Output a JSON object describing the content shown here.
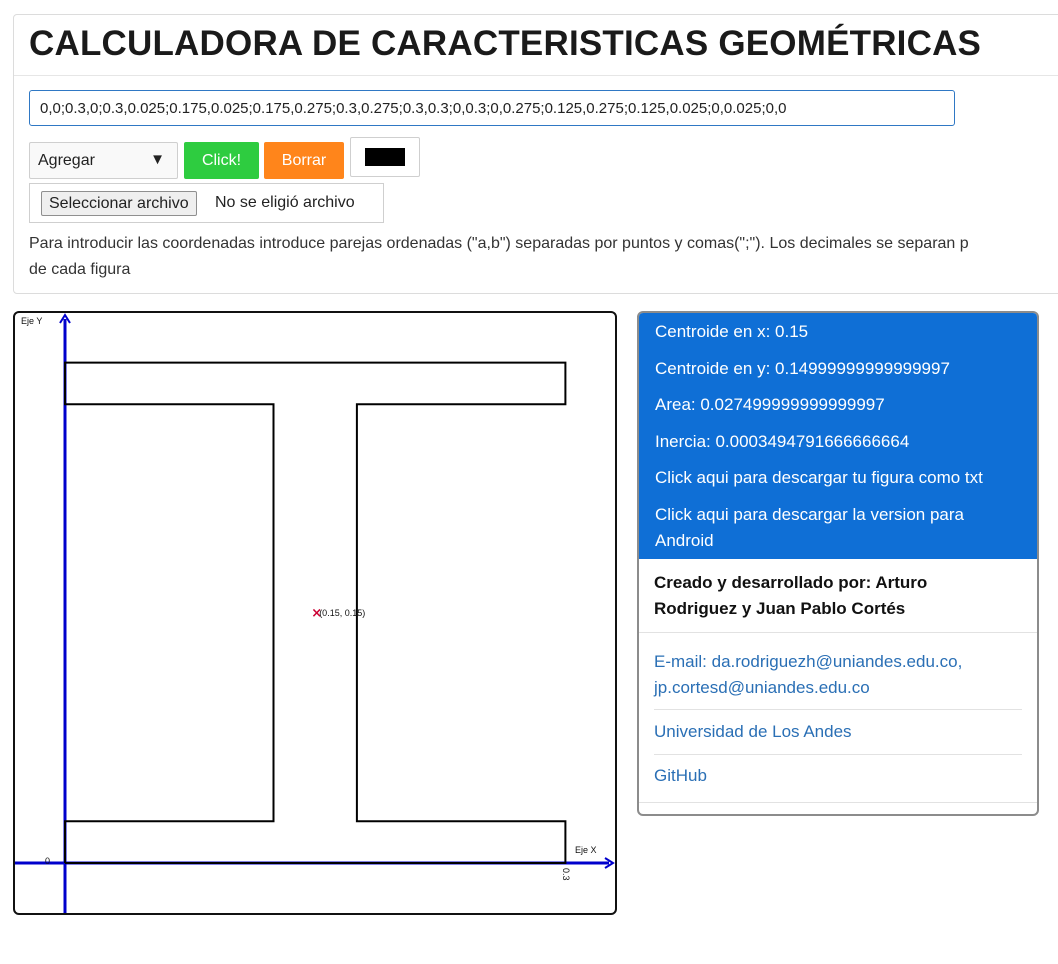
{
  "header": {
    "title": "CALCULADORA DE CARACTERISTICAS GEOMÉTRICAS"
  },
  "coordinates_input": {
    "value": "0,0;0.3,0;0.3,0.025;0.175,0.025;0.175,0.275;0.3,0.275;0.3,0.3;0,0.3;0,0.275;0.125,0.275;0.125,0.025;0,0.025;0,0"
  },
  "controls": {
    "mode_select": "Agregar",
    "click_label": "Click!",
    "clear_label": "Borrar",
    "selected_color": "#000000",
    "file_button_label": "Seleccionar archivo",
    "file_status": "No se eligió archivo"
  },
  "instructions": {
    "line1": "Para introducir las coordenadas introduce parejas ordenadas (\"a,b\") separadas por puntos y comas(\";\"). Los decimales se separan p",
    "line2": "de cada figura"
  },
  "canvas": {
    "axis_y_label": "Eje Y",
    "axis_x_label": "Eje X",
    "origin_label": "0",
    "x_tick_label": "0.3",
    "centroid_marker": "×",
    "centroid_label": "(0.15, 0.15)",
    "axis_color": "#0000cc",
    "figure_color": "#000000",
    "centroid_color": "#cc0033",
    "centroid": [
      0.15,
      0.15
    ],
    "figure_points": [
      [
        0,
        0
      ],
      [
        0.3,
        0
      ],
      [
        0.3,
        0.025
      ],
      [
        0.175,
        0.025
      ],
      [
        0.175,
        0.275
      ],
      [
        0.3,
        0.275
      ],
      [
        0.3,
        0.3
      ],
      [
        0,
        0.3
      ],
      [
        0,
        0.275
      ],
      [
        0.125,
        0.275
      ],
      [
        0.125,
        0.025
      ],
      [
        0,
        0.025
      ],
      [
        0,
        0
      ]
    ]
  },
  "results": {
    "centroid_x": "Centroide en x: 0.15",
    "centroid_y": "Centroide en y: 0.14999999999999997",
    "area": "Area: 0.027499999999999997",
    "inertia": "Inercia: 0.0003494791666666664",
    "download_txt": "Click aqui para descargar tu figura como txt",
    "download_android": "Click aqui para descargar la version para Android",
    "accent_color": "#0f6fd6"
  },
  "credits": {
    "authors": "Creado y desarrollado por: Arturo Rodriguez y Juan Pablo Cortés",
    "email": "E-mail: da.rodriguezh@uniandes.edu.co, jp.cortesd@uniandes.edu.co",
    "university": "Universidad de Los Andes",
    "github": "GitHub"
  }
}
